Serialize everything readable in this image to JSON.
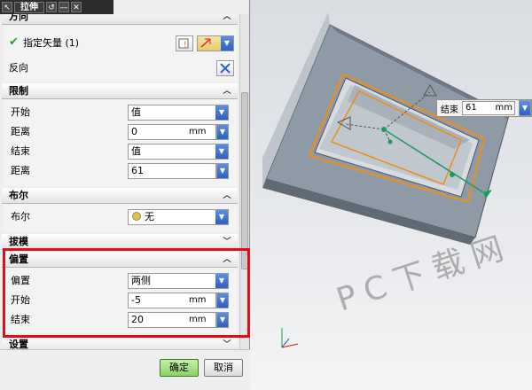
{
  "dialog": {
    "title": "拉伸",
    "title_buttons": [
      "↖",
      "↺",
      "—",
      "✕"
    ],
    "sections": {
      "direction": {
        "title": "方向",
        "specify_vector_label": "指定矢量 (1)",
        "reverse_label": "反向"
      },
      "limits": {
        "title": "限制",
        "start_label": "开始",
        "start_value": "值",
        "start_distance_label": "距离",
        "start_distance_value": "0",
        "start_distance_unit": "mm",
        "end_label": "结束",
        "end_value": "值",
        "end_distance_label": "距离",
        "end_distance_value": "61"
      },
      "boolean": {
        "title": "布尔",
        "label": "布尔",
        "value": "无"
      },
      "draft": {
        "title": "拔模"
      },
      "offset": {
        "title": "偏置",
        "offset_label": "偏置",
        "offset_value": "两侧",
        "start_label": "开始",
        "start_value": "-5",
        "start_unit": "mm",
        "end_label": "结束",
        "end_value": "20",
        "end_unit": "mm"
      },
      "settings": {
        "title": "设置"
      }
    },
    "buttons": {
      "ok": "确定",
      "cancel": "取消"
    }
  },
  "viewport": {
    "float_input": {
      "label": "结束",
      "value": "61",
      "unit": "mm"
    },
    "watermark": "PC下载网"
  },
  "colors": {
    "highlight": "#e30d18",
    "accent_blue": "#2c5fc4",
    "ok_green": "#8cd266",
    "model_orange": "#f08c1a"
  }
}
